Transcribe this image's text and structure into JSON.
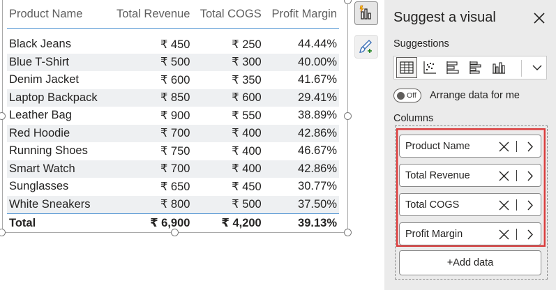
{
  "table": {
    "headers": [
      "Product Name",
      "Total Revenue",
      "Total COGS",
      "Profit Margin"
    ],
    "rows": [
      [
        "Black Jeans",
        "₹ 450",
        "₹ 250",
        "44.44%"
      ],
      [
        "Blue T-Shirt",
        "₹ 500",
        "₹ 300",
        "40.00%"
      ],
      [
        "Denim Jacket",
        "₹ 600",
        "₹ 350",
        "41.67%"
      ],
      [
        "Laptop Backpack",
        "₹ 850",
        "₹ 600",
        "29.41%"
      ],
      [
        "Leather Bag",
        "₹ 900",
        "₹ 550",
        "38.89%"
      ],
      [
        "Red Hoodie",
        "₹ 700",
        "₹ 400",
        "42.86%"
      ],
      [
        "Running Shoes",
        "₹ 750",
        "₹ 400",
        "46.67%"
      ],
      [
        "Smart Watch",
        "₹ 700",
        "₹ 400",
        "42.86%"
      ],
      [
        "Sunglasses",
        "₹ 650",
        "₹ 450",
        "30.77%"
      ],
      [
        "White Sneakers",
        "₹ 800",
        "₹ 500",
        "37.50%"
      ]
    ],
    "total": [
      "Total",
      "₹ 6,900",
      "₹ 4,200",
      "39.13%"
    ]
  },
  "side_buttons": [
    {
      "icon": "visual-suggest-icon"
    },
    {
      "icon": "format-brush-icon"
    }
  ],
  "panel": {
    "title": "Suggest a visual",
    "suggestions_label": "Suggestions",
    "suggestion_icons": [
      "table-icon",
      "scatter-icon",
      "stacked-bar-icon",
      "clustered-bar-icon",
      "column-chart-icon"
    ],
    "toggle_state": "Off",
    "toggle_label": "Arrange data for me",
    "columns_label": "Columns",
    "fields": [
      "Product Name",
      "Total Revenue",
      "Total COGS",
      "Profit Margin"
    ],
    "add_data_label": "+Add data"
  },
  "colors": {
    "panel_bg": "#ebebeb",
    "highlight_border": "#d83b3b",
    "header_rule": "#5b9bd5",
    "alt_row": "#eef0f2"
  }
}
